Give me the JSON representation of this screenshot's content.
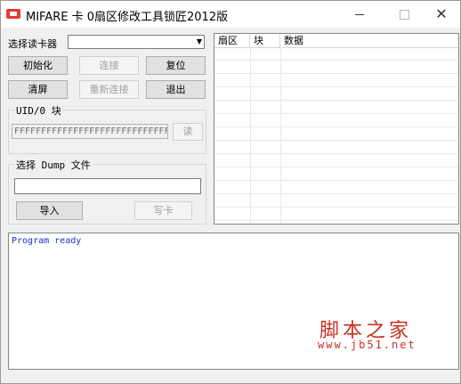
{
  "window": {
    "title": "MIFARE 卡 0扇区修改工具锁匠2012版",
    "close_glyph": "✕"
  },
  "reader": {
    "label": "选择读卡器",
    "selected": "",
    "arrow": "▼"
  },
  "buttons": {
    "init": "初始化",
    "connect": "连接",
    "reset": "复位",
    "clear": "清屏",
    "reconnect": "重新连接",
    "exit": "退出"
  },
  "uid": {
    "group_title": "UID/0 块",
    "value": "FFFFFFFFFFFFFFFFFFFFFFFFFFFFFFFF",
    "read_label": "读"
  },
  "dump": {
    "group_title": "选择 Dump 文件",
    "path": "",
    "import_label": "导入",
    "write_label": "写卡"
  },
  "table": {
    "columns": [
      "扇区",
      "块",
      "数据"
    ]
  },
  "log": {
    "lines": [
      "Program ready"
    ]
  },
  "watermark": {
    "title": "脚本之家",
    "url": "www.jb51.net"
  },
  "colors": {
    "log_text": "#1c2fc9",
    "watermark": "#c8321f",
    "app_icon": "#e23b2e"
  }
}
